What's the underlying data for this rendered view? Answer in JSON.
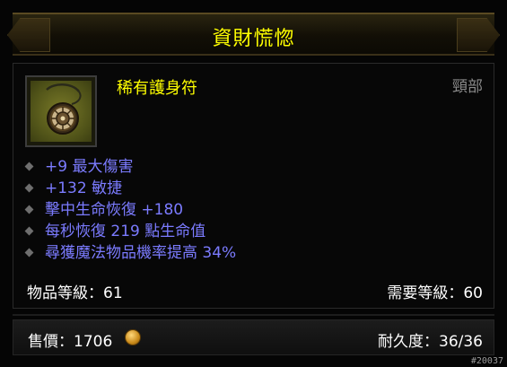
{
  "header": {
    "title": "資財慌惚"
  },
  "item": {
    "name": "稀有護身符",
    "slot": "頸部",
    "icon": "amulet-icon"
  },
  "affixes": [
    "+9 最大傷害",
    "+132 敏捷",
    "擊中生命恢復 +180",
    "每秒恢復 219 點生命值",
    "尋獲魔法物品機率提高 34%"
  ],
  "levels": {
    "item_level": "物品等級：61",
    "required_level": "需要等級：60"
  },
  "footer": {
    "price_label": "售價：",
    "price_value": "1706",
    "durability_label": "耐久度：",
    "durability_value": "36/36"
  },
  "watermark": "#20037",
  "colors": {
    "title": "#ffff00",
    "affix": "#7b7bff",
    "slot": "#8a8a8a"
  }
}
